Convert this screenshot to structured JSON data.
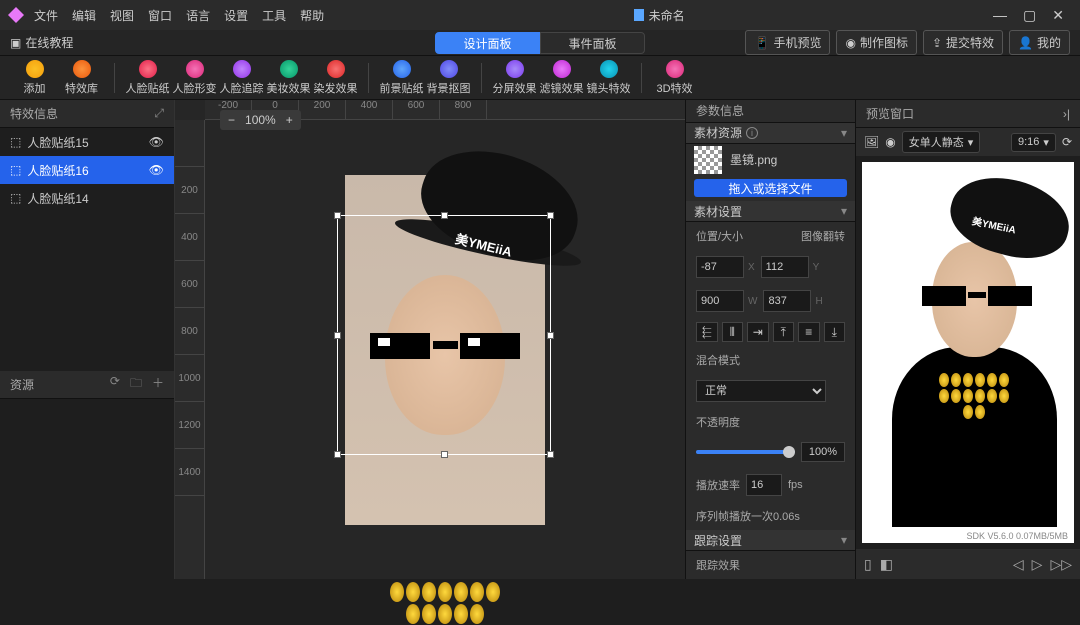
{
  "titlebar": {
    "menus": [
      "文件",
      "编辑",
      "视图",
      "窗口",
      "语言",
      "设置",
      "工具",
      "帮助"
    ],
    "title": "未命名"
  },
  "toprow": {
    "tutorial": "在线教程",
    "tabs": {
      "design": "设计面板",
      "event": "事件面板"
    },
    "right": {
      "phone": "手机预览",
      "makeicon": "制作图标",
      "submit": "提交特效",
      "mine": "我的"
    }
  },
  "tools": {
    "add": "添加",
    "fxlib": "特效库",
    "grp1": {
      "sticker": "人脸贴纸",
      "morph": "人脸形变",
      "track": "人脸追踪",
      "beauty": "美妆效果",
      "hair": "染发效果"
    },
    "grp2": {
      "fg": "前景贴纸",
      "matting": "背景抠图"
    },
    "grp3": {
      "split": "分屏效果",
      "filter": "滤镜效果",
      "lens": "镜头特效"
    },
    "grp4": {
      "threed": "3D特效"
    }
  },
  "leftpanel": {
    "header": "特效信息",
    "layers": [
      {
        "name": "人脸贴纸15"
      },
      {
        "name": "人脸贴纸16"
      },
      {
        "name": "人脸贴纸14"
      }
    ],
    "resources": "资源"
  },
  "canvas": {
    "zoom": "100%",
    "hat_text": "美YMEiiA",
    "rulerH": [
      "-200",
      "0",
      "200",
      "400",
      "600",
      "800"
    ],
    "rulerV": [
      "200",
      "400",
      "600",
      "800",
      "1000",
      "1200",
      "1400"
    ]
  },
  "params": {
    "panel_title": "参数信息",
    "asset_section": "素材资源",
    "asset_file": "墨镜.png",
    "drop_hint": "拖入或选择文件",
    "settings": "素材设置",
    "pos_label": "位置/大小",
    "flip_label": "图像翻转",
    "x": "-87",
    "y": "112",
    "w": "900",
    "h": "837",
    "blend_label": "混合模式",
    "blend_value": "正常",
    "opacity_label": "不透明度",
    "opacity": "100%",
    "playrate_label": "播放速率",
    "playrate": "16",
    "fps": "fps",
    "seq_note": "序列帧播放一次0.06s",
    "follow_section": "跟踪设置",
    "follow_fx": "跟踪效果"
  },
  "preview": {
    "header": "预览窗口",
    "pose": "女单人静态",
    "ratio": "9:16",
    "hat_text": "美YMEiiA",
    "sdk": "SDK V5.6.0   0.07MB/5MB"
  }
}
